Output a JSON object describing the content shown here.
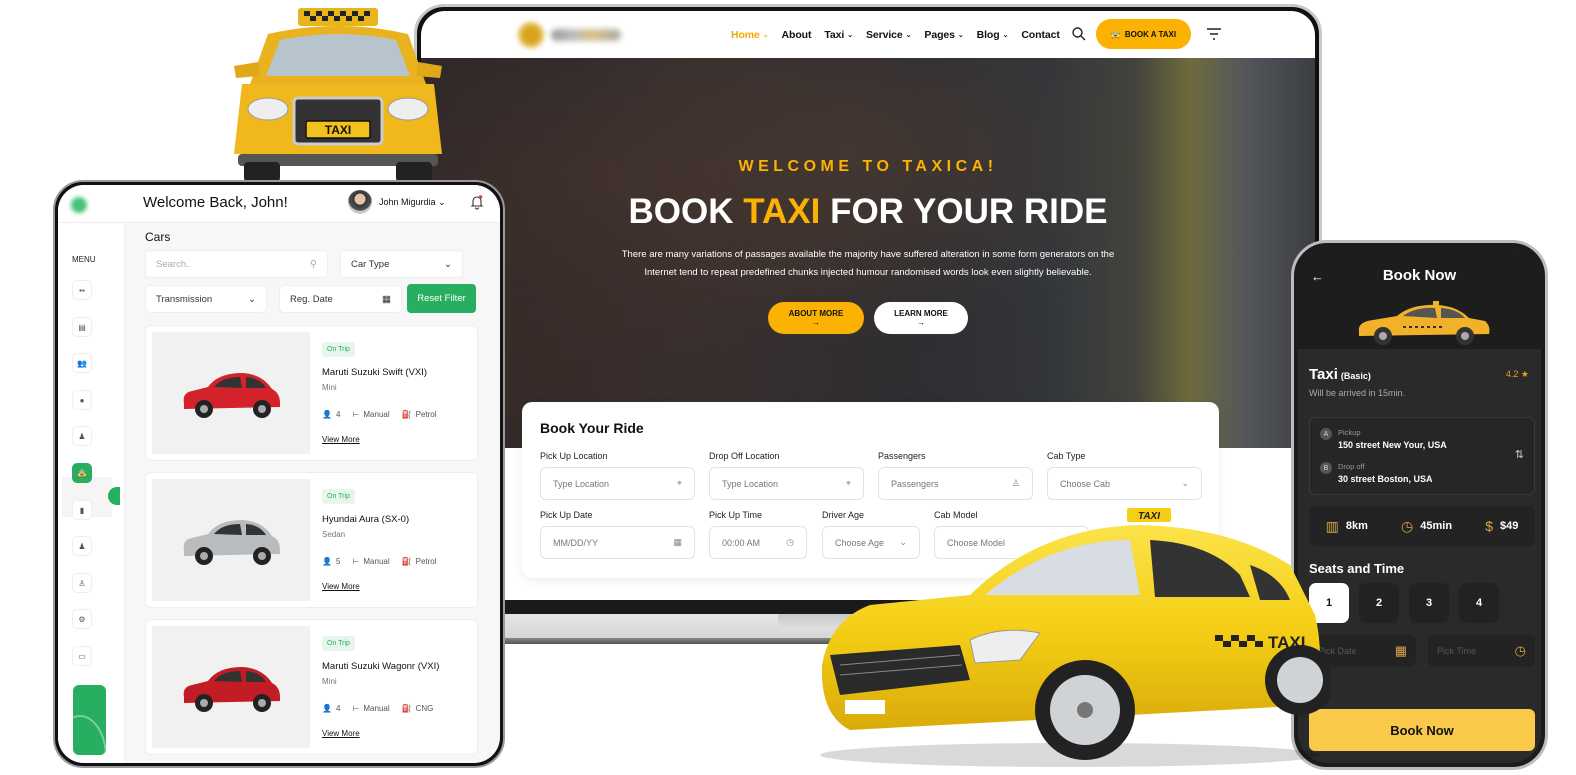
{
  "website": {
    "nav": {
      "items": [
        {
          "label": "Home",
          "has_dropdown": true,
          "active": true
        },
        {
          "label": "About",
          "has_dropdown": false,
          "active": false
        },
        {
          "label": "Taxi",
          "has_dropdown": true,
          "active": false
        },
        {
          "label": "Service",
          "has_dropdown": true,
          "active": false
        },
        {
          "label": "Pages",
          "has_dropdown": true,
          "active": false
        },
        {
          "label": "Blog",
          "has_dropdown": true,
          "active": false
        },
        {
          "label": "Contact",
          "has_dropdown": false,
          "active": false
        }
      ],
      "cta_label": "BOOK A TAXI",
      "icons": {
        "search": "search-icon",
        "menu": "filter-menu-icon",
        "cta": "car-icon"
      }
    },
    "hero": {
      "eyebrow": "WELCOME TO TAXICA!",
      "title_before": "BOOK ",
      "title_highlight": "TAXI",
      "title_after": " FOR YOUR RIDE",
      "description": "There are many variations of passages available the majority have suffered alteration in some form generators on the Internet tend to repeat predefined chunks injected humour randomised words look even slightly believable.",
      "primary_button": "ABOUT MORE →",
      "secondary_button": "LEARN MORE →"
    },
    "booking_form": {
      "title": "Book Your Ride",
      "fields": [
        {
          "label": "Pick Up Location",
          "placeholder": "Type Location",
          "icon": "map-pin-icon"
        },
        {
          "label": "Drop Off Location",
          "placeholder": "Type Location",
          "icon": "map-pin-icon"
        },
        {
          "label": "Passengers",
          "placeholder": "Passengers",
          "icon": "user-icon"
        },
        {
          "label": "Cab Type",
          "placeholder": "Choose Cab",
          "icon": "chevron-down-icon"
        },
        {
          "label": "Pick Up Date",
          "placeholder": "MM/DD/YY",
          "icon": "calendar-icon"
        },
        {
          "label": "Pick Up Time",
          "placeholder": "00:00 AM",
          "icon": "clock-icon"
        },
        {
          "label": "Driver Age",
          "placeholder": "Choose Age",
          "icon": "chevron-down-icon"
        },
        {
          "label": "Cab Model",
          "placeholder": "Choose Model",
          "icon": "chevron-down-icon"
        }
      ]
    },
    "colors": {
      "accent": "#fbb203",
      "text": "#111111"
    }
  },
  "dashboard": {
    "welcome": "Welcome Back, John!",
    "user_name": "John Migurdia",
    "menu_label": "MENU",
    "sidebar_icons": [
      "dashboard-icon",
      "calendar-icon",
      "users-icon",
      "user-icon",
      "driver-icon",
      "car-icon",
      "clipboard-icon",
      "driver-icon",
      "user-settings-icon",
      "settings-icon",
      "wallet-icon"
    ],
    "active_sidebar_index": 5,
    "section_title": "Cars",
    "filters": {
      "search_placeholder": "Search..",
      "car_type": "Car Type",
      "transmission": "Transmission",
      "reg_date": "Reg. Date",
      "reset_label": "Reset Filter"
    },
    "cars": [
      {
        "status": "On Trip",
        "name": "Maruti Suzuki Swift (VXI)",
        "type": "Mini",
        "seats": "4",
        "transmission": "Manual",
        "fuel": "Petrol",
        "link": "View More",
        "color": "#d4222a"
      },
      {
        "status": "On Trip",
        "name": "Hyundai Aura (SX-0)",
        "type": "Sedan",
        "seats": "5",
        "transmission": "Manual",
        "fuel": "Petrol",
        "link": "View More",
        "color": "#b9bcbf"
      },
      {
        "status": "On Trip",
        "name": "Maruti Suzuki Wagonr (VXI)",
        "type": "Mini",
        "seats": "4",
        "transmission": "Manual",
        "fuel": "CNG",
        "link": "View More",
        "color": "#c21c25"
      }
    ],
    "colors": {
      "primary": "#27ae60"
    }
  },
  "mobile": {
    "title": "Book Now",
    "taxi_name": "Taxi",
    "taxi_class": "(Basic)",
    "rating": "4.2",
    "arrival": "Will be arrived in 15min.",
    "pickup_marker": "A",
    "pickup_label": "Pickup",
    "pickup_address": "150 street New Your, USA",
    "dropoff_marker": "B",
    "dropoff_label": "Drop off",
    "dropoff_address": "30 street Boston, USA",
    "stats": [
      {
        "icon": "map-icon",
        "glyph": "▥",
        "value": "8km"
      },
      {
        "icon": "clock-icon",
        "glyph": "◷",
        "value": "45min"
      },
      {
        "icon": "dollar-icon",
        "glyph": "$",
        "value": "$49"
      }
    ],
    "seats_title": "Seats and Time",
    "seats": [
      "1",
      "2",
      "3",
      "4"
    ],
    "selected_seat": "1",
    "pick_date_placeholder": "Pick Date",
    "pick_time_placeholder": "Pick Time",
    "book_button": "Book Now",
    "colors": {
      "accent": "#fbc94a",
      "bg": "#2a2a2a"
    }
  }
}
